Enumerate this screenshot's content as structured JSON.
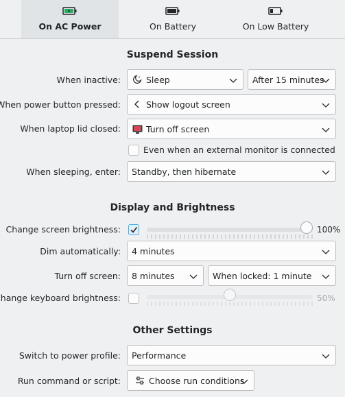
{
  "tabs": [
    {
      "label": "On AC Power",
      "icon": "battery-charging-icon",
      "active": true
    },
    {
      "label": "On Battery",
      "icon": "battery-full-icon",
      "active": false
    },
    {
      "label": "On Low Battery",
      "icon": "battery-low-icon",
      "active": false
    }
  ],
  "suspend": {
    "title": "Suspend Session",
    "when_inactive_label": "When inactive:",
    "when_inactive_value": "Sleep",
    "when_inactive_delay": "After 15 minutes",
    "power_button_label": "When power button pressed:",
    "power_button_value": "Show logout screen",
    "lid_label": "When laptop lid closed:",
    "lid_value": "Turn off screen",
    "external_monitor_label": "Even when an external monitor is connected",
    "external_monitor_checked": false,
    "sleeping_label": "When sleeping, enter:",
    "sleeping_value": "Standby, then hibernate"
  },
  "display": {
    "title": "Display and Brightness",
    "screen_brightness_label": "Change screen brightness:",
    "screen_brightness_checked": true,
    "screen_brightness_value": "100%",
    "screen_brightness_fraction": 1.0,
    "dim_label": "Dim automatically:",
    "dim_value": "4 minutes",
    "turn_off_label": "Turn off screen:",
    "turn_off_value": "8 minutes",
    "turn_off_locked_value": "When locked: 1 minute",
    "keyboard_brightness_label": "Change keyboard brightness:",
    "keyboard_brightness_checked": false,
    "keyboard_brightness_value": "50%",
    "keyboard_brightness_fraction": 0.5
  },
  "other": {
    "title": "Other Settings",
    "power_profile_label": "Switch to power profile:",
    "power_profile_value": "Performance",
    "run_command_label": "Run command or script:",
    "run_command_value": "Choose run conditions"
  },
  "colors": {
    "accent": "#3daee9",
    "background": "#eff0f1",
    "active_tab": "#e1e4e7"
  }
}
